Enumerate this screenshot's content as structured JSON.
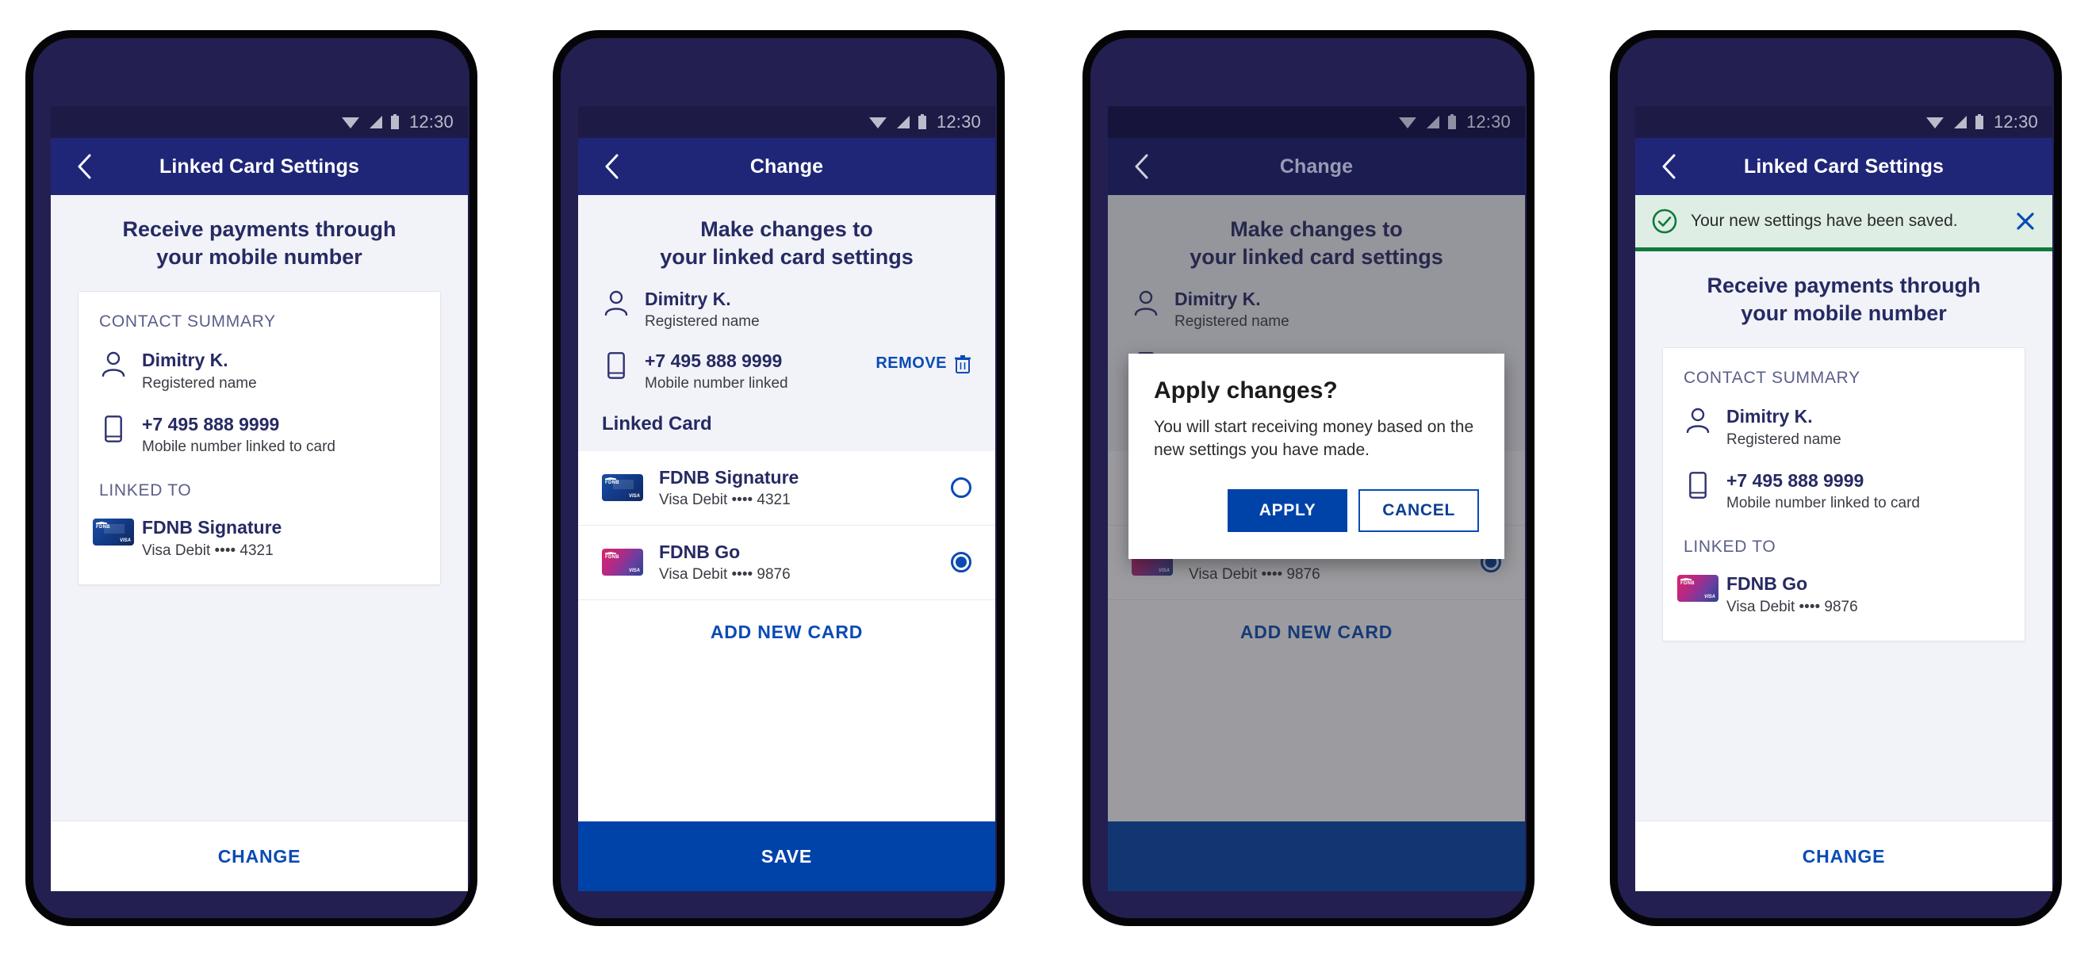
{
  "statusbar": {
    "time": "12:30",
    "icons": [
      "wifi-icon",
      "signal-icon",
      "battery-icon"
    ]
  },
  "colors": {
    "appbar": "#1f2678",
    "statusbar": "#1d1a46",
    "accent_blue": "#0a4bb5",
    "solid_blue": "#0043a8",
    "navy_text": "#262a63",
    "success_green": "#0f7a3d",
    "success_bg": "#dfeee4",
    "screen_bg": "#f2f3f8",
    "bezel": "#231f50"
  },
  "contact": {
    "section_label": "CONTACT SUMMARY",
    "name": "Dimitry K.",
    "name_caption": "Registered name",
    "phone": "+7 495 888 9999",
    "phone_caption": "Mobile number linked to card",
    "phone_caption_short": "Mobile number linked",
    "linked_label": "LINKED TO"
  },
  "cards": {
    "signature": {
      "name": "FDNB Signature",
      "detail": "Visa Debit •••• 4321",
      "art": "blue",
      "logo": "FDNB",
      "network": "VISA"
    },
    "go": {
      "name": "FDNB Go",
      "detail": "Visa Debit •••• 9876",
      "art": "pink",
      "logo": "FDNB",
      "network": "VISA"
    }
  },
  "screens": [
    {
      "id": "linked-card-settings",
      "appbar_title": "Linked Card Settings",
      "headline_line1": "Receive payments through",
      "headline_line2": "your mobile number",
      "bottom_button": "CHANGE"
    },
    {
      "id": "change",
      "appbar_title": "Change",
      "headline_line1": "Make changes to",
      "headline_line2": "your linked card settings",
      "remove_label": "REMOVE",
      "linked_card_label": "Linked Card",
      "add_new_card": "ADD NEW CARD",
      "bottom_button": "SAVE"
    },
    {
      "id": "change-dialog",
      "appbar_title": "Change",
      "headline_line1": "Make changes to",
      "headline_line2": "your linked card settings",
      "linked_card_label": "Linked Card",
      "add_new_card": "ADD NEW CARD",
      "dialog": {
        "title": "Apply changes?",
        "body": "You will start receiving money based on the new settings you have made.",
        "apply": "APPLY",
        "cancel": "CANCEL"
      }
    },
    {
      "id": "linked-card-settings-saved",
      "appbar_title": "Linked Card Settings",
      "banner_message": "Your new settings have been saved.",
      "headline_line1": "Receive payments through",
      "headline_line2": "your mobile number",
      "bottom_button": "CHANGE"
    }
  ]
}
